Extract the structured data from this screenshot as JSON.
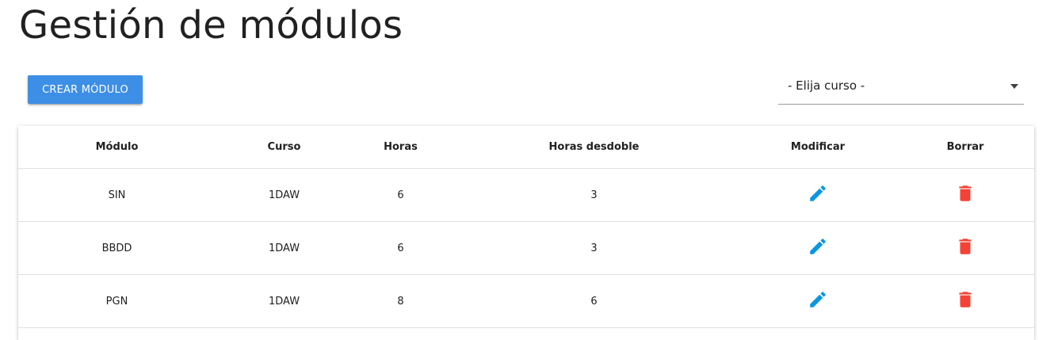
{
  "page": {
    "title": "Gestión de módulos"
  },
  "toolbar": {
    "create_label": "CREAR MÓDULO"
  },
  "course_select": {
    "selected": "- Elija curso -",
    "icon": "arrow-drop-down-icon"
  },
  "table": {
    "headers": [
      "Módulo",
      "Curso",
      "Horas",
      "Horas desdoble",
      "Modificar",
      "Borrar"
    ],
    "rows": [
      {
        "modulo": "SIN",
        "curso": "1DAW",
        "horas": "6",
        "desdoble": "3"
      },
      {
        "modulo": "BBDD",
        "curso": "1DAW",
        "horas": "6",
        "desdoble": "3"
      },
      {
        "modulo": "PGN",
        "curso": "1DAW",
        "horas": "8",
        "desdoble": "6"
      }
    ],
    "modify_icon": "pencil-icon",
    "delete_icon": "trash-icon"
  },
  "colors": {
    "primary_button": "#3d8fe6",
    "edit_icon": "#0b96e0",
    "delete_icon": "#f44336",
    "divider": "#e0e0e0"
  }
}
